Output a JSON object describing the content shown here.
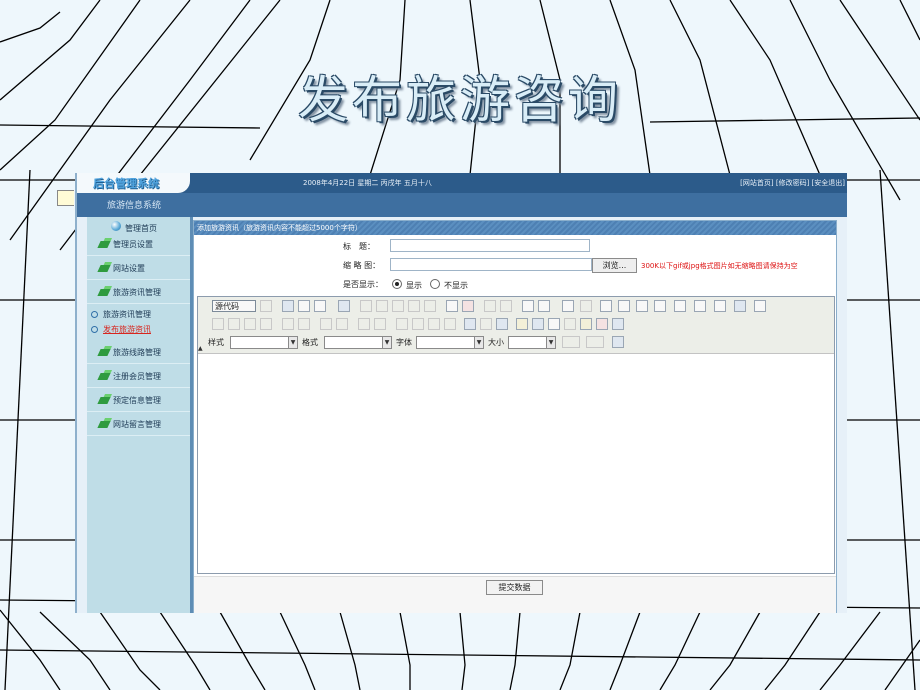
{
  "slide": {
    "title": "发布旅游咨询"
  },
  "topbar": {
    "logo": "后台管理系统",
    "date": "2008年4月22日 星期二 丙戌年 五月十八",
    "links": "[网站首页] [修改密码] [安全退出]"
  },
  "subbar": {
    "system_name": "旅游信息系统"
  },
  "sidebar": {
    "home": "管理首页",
    "items": [
      {
        "label": "管理员设置"
      },
      {
        "label": "网站设置"
      },
      {
        "label": "旅游资讯管理"
      },
      {
        "label": "旅游线路管理"
      },
      {
        "label": "注册会员管理"
      },
      {
        "label": "预定信息管理"
      },
      {
        "label": "网站留言管理"
      }
    ],
    "subitems": [
      {
        "label": "旅游资讯管理",
        "active": false
      },
      {
        "label": "发布旅游资讯",
        "active": true
      }
    ]
  },
  "form": {
    "header": "添加旅游资讯（旅游资讯内容不能超过5000个字符）",
    "title_label": "标　题：",
    "title_value": "",
    "thumb_label": "缩 略 图：",
    "thumb_value": "",
    "browse_label": "浏览...",
    "thumb_hint": "300K以下gif或jpg格式图片如无缩略图请保持为空",
    "display_label": "是否显示：",
    "display_options": [
      {
        "label": "显示",
        "selected": true
      },
      {
        "label": "不显示",
        "selected": false
      }
    ]
  },
  "editor": {
    "source_button": "源代码",
    "style_label": "样式",
    "format_label": "格式",
    "font_label": "字体",
    "size_label": "大小",
    "style_value": "",
    "format_value": "",
    "font_value": "",
    "size_value": "",
    "content": ""
  },
  "actions": {
    "submit": "提交数据"
  },
  "colors": {
    "topbar": "#2c5b8a",
    "subbar": "#3e6fa0",
    "sidebar": "#bfdde7",
    "hint": "#dd1111",
    "active_nav": "#d7261f"
  }
}
